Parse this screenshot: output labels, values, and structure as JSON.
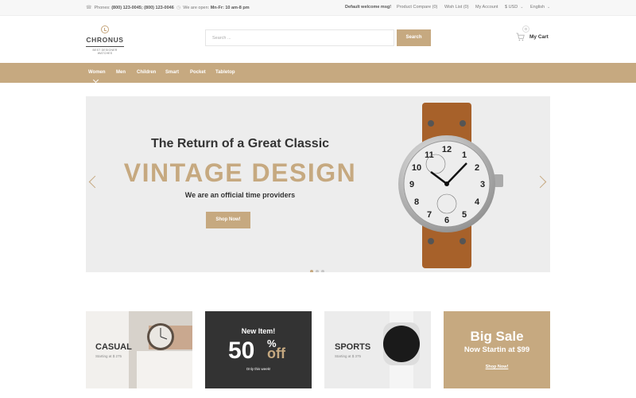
{
  "colors": {
    "accent": "#c6a980",
    "dark": "#333333"
  },
  "topbar": {
    "phone_label": "Phones:",
    "phone_numbers": "(800) 123-0045; (800) 123-0046",
    "hours_label": "We are open:",
    "hours_value": "Mn-Fr: 10 am-8 pm",
    "welcome": "Default welcome msg!",
    "compare": "Product Compare (0)",
    "wishlist": "Wish List (0)",
    "account": "My Account",
    "currency": "$ USD",
    "language": "English"
  },
  "header": {
    "logo_name": "CHRONUS",
    "logo_tagline": "BEST DESIGNER WATCHES",
    "search_placeholder": "Search ...",
    "search_button": "Search",
    "cart_count": "0",
    "cart_label": "My Cart"
  },
  "nav": {
    "items": [
      {
        "label": "Women"
      },
      {
        "label": "Men"
      },
      {
        "label": "Children"
      },
      {
        "label": "Smart"
      },
      {
        "label": "Pocket"
      },
      {
        "label": "Tabletop"
      }
    ]
  },
  "hero": {
    "subtitle": "The Return of a Great Classic",
    "title": "VINTAGE DESIGN",
    "tagline": "We are an official time providers",
    "button": "Shop Now!",
    "slides_total": 3,
    "active_slide": 1
  },
  "banners": {
    "casual": {
      "title": "CASUAL",
      "price": "Starting at $ 275"
    },
    "promo": {
      "heading": "New Item!",
      "value": "50",
      "symbol": "%",
      "suffix": "off",
      "note": "Only this week!"
    },
    "sports": {
      "title": "SPORTS",
      "price": "Starting at $ 375"
    },
    "sale": {
      "title": "Big Sale",
      "subtitle": "Now Startin at $99",
      "link": "Shop Now!"
    }
  }
}
